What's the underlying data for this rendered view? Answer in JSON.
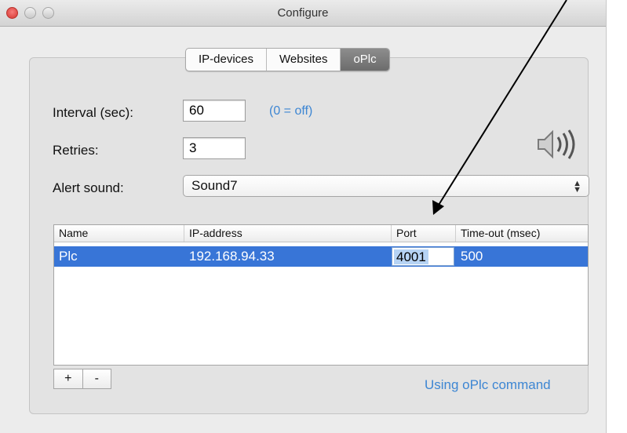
{
  "window": {
    "title": "Configure"
  },
  "tabs": [
    {
      "label": "IP-devices",
      "selected": false
    },
    {
      "label": "Websites",
      "selected": false
    },
    {
      "label": "oPlc",
      "selected": true
    }
  ],
  "form": {
    "interval_label": "Interval (sec):",
    "interval_value": "60",
    "interval_hint": "(0 = off)",
    "retries_label": "Retries:",
    "retries_value": "3",
    "alert_label": "Alert sound:",
    "alert_value": "Sound7"
  },
  "table": {
    "columns": [
      "Name",
      "IP-address",
      "Port",
      "Time-out (msec)"
    ],
    "rows": [
      {
        "name": "Plc",
        "ip": "192.168.94.33",
        "port": "4001",
        "timeout": "500",
        "selected": true
      }
    ]
  },
  "buttons": {
    "add": "+",
    "remove": "-"
  },
  "footer": {
    "status": "Using oPlc command"
  },
  "colors": {
    "selection": "#3875d7",
    "link": "#3d86d3",
    "selected_tab": "#7a7a7a"
  },
  "icons": {
    "sound": "speaker-icon"
  }
}
